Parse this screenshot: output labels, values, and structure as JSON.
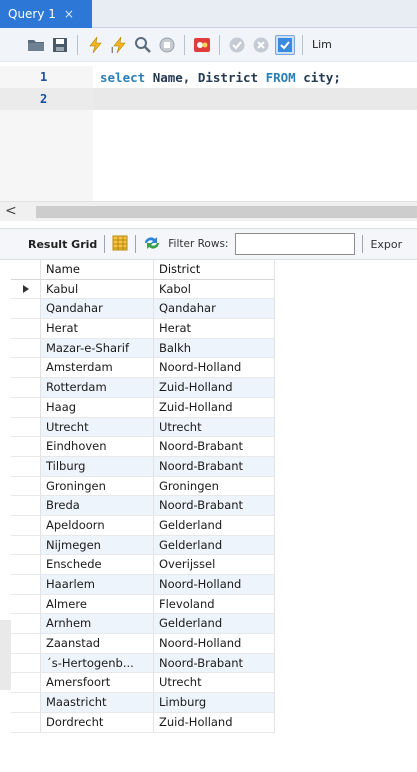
{
  "tab": {
    "title": "Query 1",
    "close": "×"
  },
  "toolbar": {
    "icons": [
      "open-folder-icon",
      "save-icon",
      "execute-icon",
      "execute-current-icon",
      "explain-icon",
      "stop-icon",
      "toggle-results-icon",
      "commit-icon",
      "rollback-icon",
      "autocommit-icon"
    ],
    "limit_label": "Lim"
  },
  "editor": {
    "lines": [
      {
        "num": "1",
        "tokens": [
          {
            "t": "select ",
            "k": "kw"
          },
          {
            "t": "Name, District ",
            "k": "ident"
          },
          {
            "t": "FROM ",
            "k": "kw"
          },
          {
            "t": "city;",
            "k": "ident"
          }
        ]
      },
      {
        "num": "2",
        "tokens": []
      }
    ]
  },
  "scroll": {
    "left_arrow": "<"
  },
  "results_toolbar": {
    "result_grid_label": "Result Grid",
    "filter_label": "Filter Rows:",
    "filter_value": "",
    "export_label": "Expor"
  },
  "grid": {
    "columns": [
      "Name",
      "District"
    ],
    "selected_row": 0,
    "rows": [
      [
        "Kabul",
        "Kabol"
      ],
      [
        "Qandahar",
        "Qandahar"
      ],
      [
        "Herat",
        "Herat"
      ],
      [
        "Mazar-e-Sharif",
        "Balkh"
      ],
      [
        "Amsterdam",
        "Noord-Holland"
      ],
      [
        "Rotterdam",
        "Zuid-Holland"
      ],
      [
        "Haag",
        "Zuid-Holland"
      ],
      [
        "Utrecht",
        "Utrecht"
      ],
      [
        "Eindhoven",
        "Noord-Brabant"
      ],
      [
        "Tilburg",
        "Noord-Brabant"
      ],
      [
        "Groningen",
        "Groningen"
      ],
      [
        "Breda",
        "Noord-Brabant"
      ],
      [
        "Apeldoorn",
        "Gelderland"
      ],
      [
        "Nijmegen",
        "Gelderland"
      ],
      [
        "Enschede",
        "Overijssel"
      ],
      [
        "Haarlem",
        "Noord-Holland"
      ],
      [
        "Almere",
        "Flevoland"
      ],
      [
        "Arnhem",
        "Gelderland"
      ],
      [
        "Zaanstad",
        "Noord-Holland"
      ],
      [
        "´s-Hertogenb...",
        "Noord-Brabant"
      ],
      [
        "Amersfoort",
        "Utrecht"
      ],
      [
        "Maastricht",
        "Limburg"
      ],
      [
        "Dordrecht",
        "Zuid-Holland"
      ]
    ]
  },
  "colors": {
    "tab_active": "#2d78d6",
    "keyword": "#2a7fb8",
    "row_alt": "#eef4fb"
  }
}
